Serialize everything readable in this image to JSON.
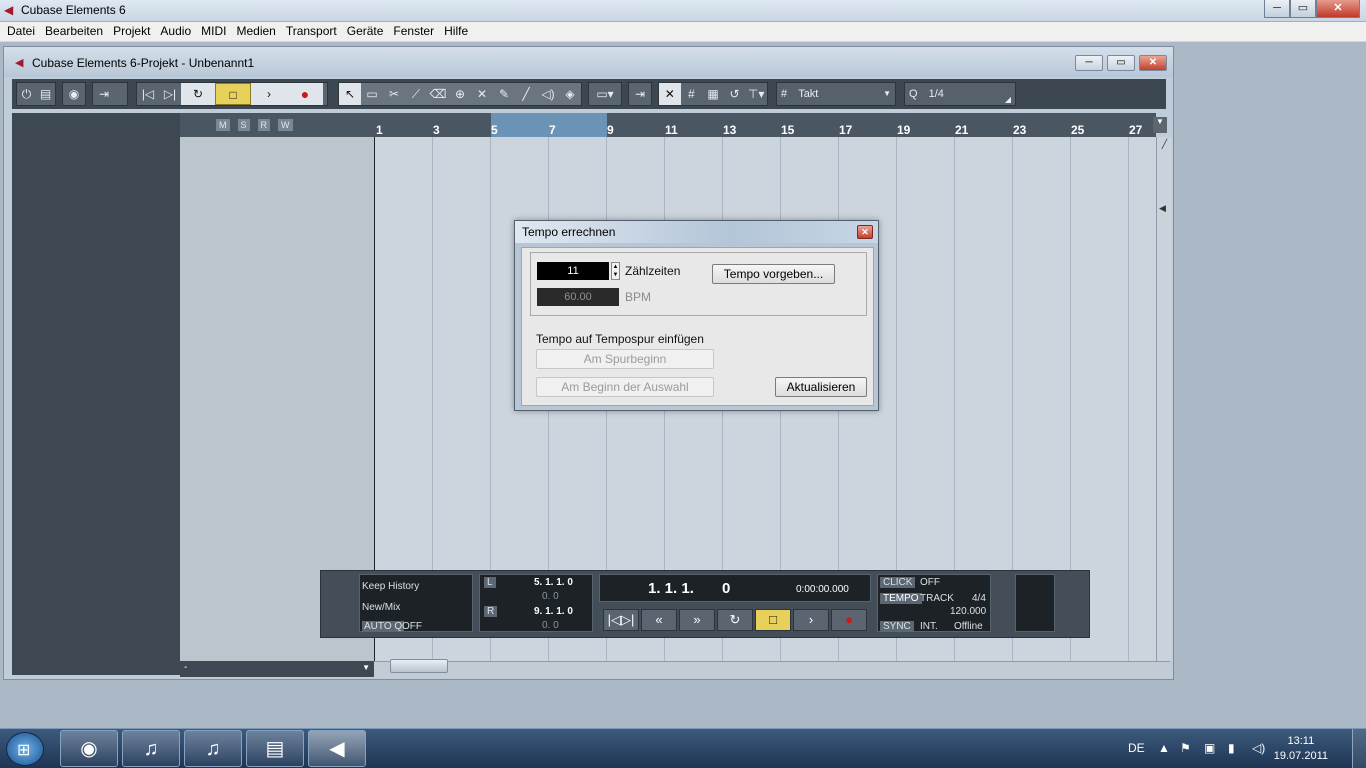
{
  "app": {
    "title": "Cubase Elements 6",
    "controls": {
      "minimize": "─",
      "maximize": "▭",
      "close": "✕"
    }
  },
  "menu": [
    "Datei",
    "Bearbeiten",
    "Projekt",
    "Audio",
    "MIDI",
    "Medien",
    "Transport",
    "Geräte",
    "Fenster",
    "Hilfe"
  ],
  "project_window": {
    "title": "Cubase Elements 6-Projekt - Unbenannt1",
    "controls": {
      "minimize": "─",
      "maximize": "▭",
      "close": "✕"
    }
  },
  "toolbar": {
    "snap_mode": "Takt",
    "quantize_label": "Q",
    "quantize_value": "1/4"
  },
  "tracklist_header": [
    "M",
    "S",
    "R",
    "W"
  ],
  "ruler": {
    "bars": [
      "1",
      "3",
      "5",
      "7",
      "9",
      "11",
      "13",
      "15",
      "17",
      "19",
      "21",
      "23",
      "25",
      "27"
    ]
  },
  "bottom_left": "-",
  "transport": {
    "history_label": "Keep History",
    "newmix_label": "New/Mix",
    "autoq_label": "AUTO Q",
    "autoq_value": "OFF",
    "left_locator": "5. 1. 1.   0",
    "left_sub": "0.   0",
    "right_locator": "9. 1. 1.   0",
    "right_sub": "0.   0",
    "position_bars": "1. 1. 1.",
    "position_ticks": "0",
    "time": "0:00:00.000",
    "click_label": "CLICK",
    "click_value": "OFF",
    "tempo_label": "TEMPO",
    "tempo_mode": "TRACK",
    "signature": "4/4",
    "tempo_value": "120.000",
    "sync_label": "SYNC",
    "sync_source": "INT.",
    "sync_state": "Offline",
    "locator_L": "L",
    "locator_R": "R"
  },
  "dialog": {
    "title": "Tempo errechnen",
    "beats_value": "11",
    "beats_label": "Zählzeiten",
    "set_tempo_button": "Tempo vorgeben...",
    "bpm_value": "60.00",
    "bpm_label": "BPM",
    "insert_section_label": "Tempo auf Tempospur einfügen",
    "at_track_start_button": "Am Spurbeginn",
    "at_selection_start_button": "Am Beginn der Auswahl",
    "update_button": "Aktualisieren"
  },
  "taskbar": {
    "language": "DE",
    "time": "13:11",
    "date": "19.07.2011"
  }
}
